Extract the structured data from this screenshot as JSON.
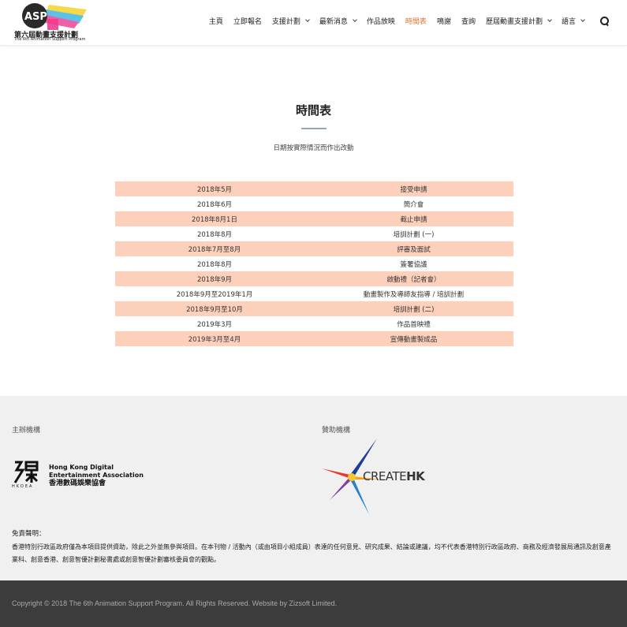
{
  "header": {
    "logo_caption": "第六屆動畫支援計劃",
    "logo_sub": "The 6th Animation Support Program",
    "nav": [
      {
        "label": "主頁",
        "dropdown": false,
        "active": false
      },
      {
        "label": "立即報名",
        "dropdown": false,
        "active": false
      },
      {
        "label": "支援計劃",
        "dropdown": true,
        "active": false
      },
      {
        "label": "最新消息",
        "dropdown": true,
        "active": false
      },
      {
        "label": "作品放映",
        "dropdown": false,
        "active": false
      },
      {
        "label": "時間表",
        "dropdown": false,
        "active": true
      },
      {
        "label": "鳴謝",
        "dropdown": false,
        "active": false
      },
      {
        "label": "查詢",
        "dropdown": false,
        "active": false
      },
      {
        "label": "歷屆動畫支援計劃",
        "dropdown": true,
        "active": false
      },
      {
        "label": "語言",
        "dropdown": true,
        "active": false
      }
    ],
    "search_icon": "search-icon"
  },
  "main": {
    "title": "時間表",
    "subtitle": "日期按實際情況而作出改動",
    "schedule": [
      {
        "date": "2018年5月",
        "event": "接受申請"
      },
      {
        "date": "2018年6月",
        "event": "簡介會"
      },
      {
        "date": "2018年8月1日",
        "event": "截止申請"
      },
      {
        "date": "2018年8月",
        "event": "培訓計劃 (一)"
      },
      {
        "date": "2018年7月至8月",
        "event": "評審及面試"
      },
      {
        "date": "2018年8月",
        "event": "簽署協議"
      },
      {
        "date": "2018年9月",
        "event": "啟動禮（記者會）"
      },
      {
        "date": "2018年9月至2019年1月",
        "event": "動畫製作及導師友指導 / 培訓計劃"
      },
      {
        "date": "2018年9月至10月",
        "event": "培訓計劃 (二)"
      },
      {
        "date": "2019年3月",
        "event": "作品首映禮"
      },
      {
        "date": "2019年3月至4月",
        "event": "宣傳動畫製成品"
      }
    ],
    "row_shade_color": "#fdd0bc"
  },
  "footer": {
    "organizer_label": "主辦機構",
    "sponsor_label": "贊助機構",
    "hkdea": {
      "en_line1": "Hong Kong Digital",
      "en_line2": "Entertainment Association",
      "zh": "香港數碼娛樂協會",
      "abbr": "HKDEA"
    },
    "createhk": {
      "light": "CREATE",
      "bold": "HK"
    },
    "disclaimer_title": "免責聲明：",
    "disclaimer_body": "香港特別行政區政府僅為本項目提供資助，除此之外並無參與項目。在本刊物 / 活動內（或由項目小組成員）表達的任何意見、研究成果、結論或建議，均不代表香港特別行政區政府、商務及經濟發展局通訊及創意產業科、創意香港、創意智優計劃秘書處或創意智優計劃審核委員會的觀點。",
    "copyright": "Copyright © 2018 The 6th Animation Support Program. All Rights Reserved. Website by Zizsoft Limited."
  }
}
